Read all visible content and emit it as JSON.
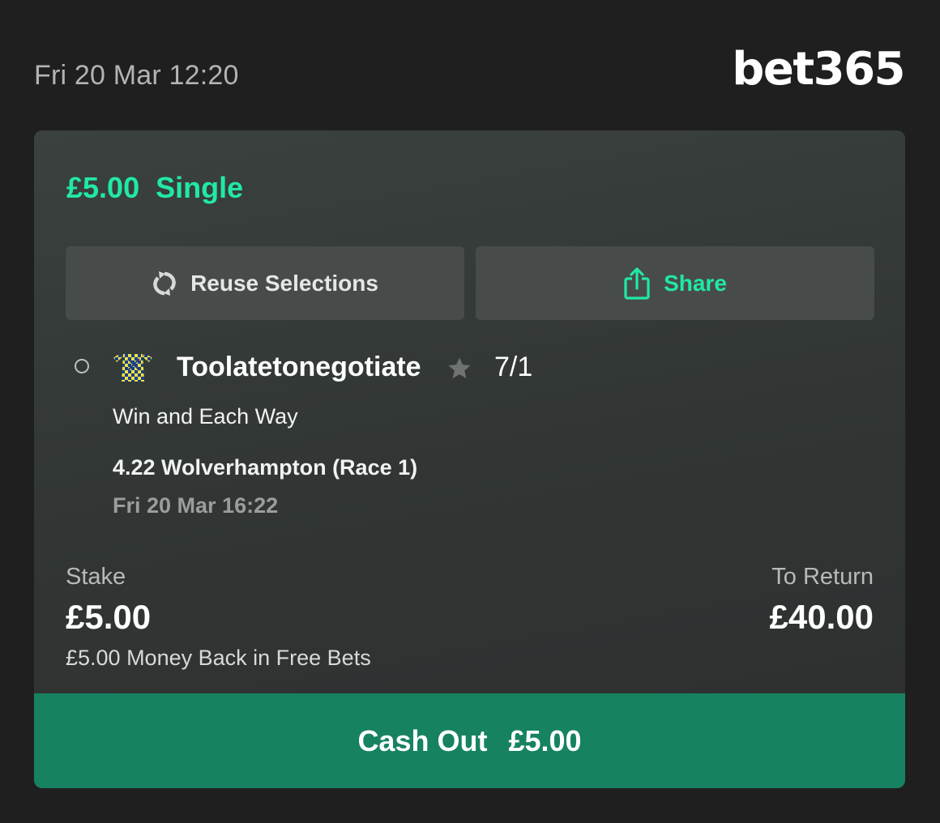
{
  "header": {
    "datetime": "Fri 20 Mar 12:20",
    "logo_text": "bet365"
  },
  "bet": {
    "amount": "£5.00",
    "type": "Single",
    "accent_color": "#21e8a6",
    "actions": {
      "reuse_label": "Reuse Selections",
      "reuse_icon": "refresh-icon",
      "share_label": "Share",
      "share_icon": "share-icon"
    },
    "selection": {
      "horse": "Toolatetonegotiate",
      "odds": "7/1",
      "market": "Win and Each Way",
      "race": "4.22 Wolverhampton (Race 1)",
      "race_time": "Fri 20 Mar 16:22",
      "silks_icon": "jockey-silks-icon",
      "favourite_icon": "star-icon"
    },
    "stake": {
      "label": "Stake",
      "value": "£5.00"
    },
    "to_return": {
      "label": "To Return",
      "value": "£40.00"
    },
    "offer": "£5.00 Money Back in Free Bets",
    "cashout": {
      "label": "Cash Out",
      "value": "£5.00",
      "color": "#168262"
    }
  }
}
